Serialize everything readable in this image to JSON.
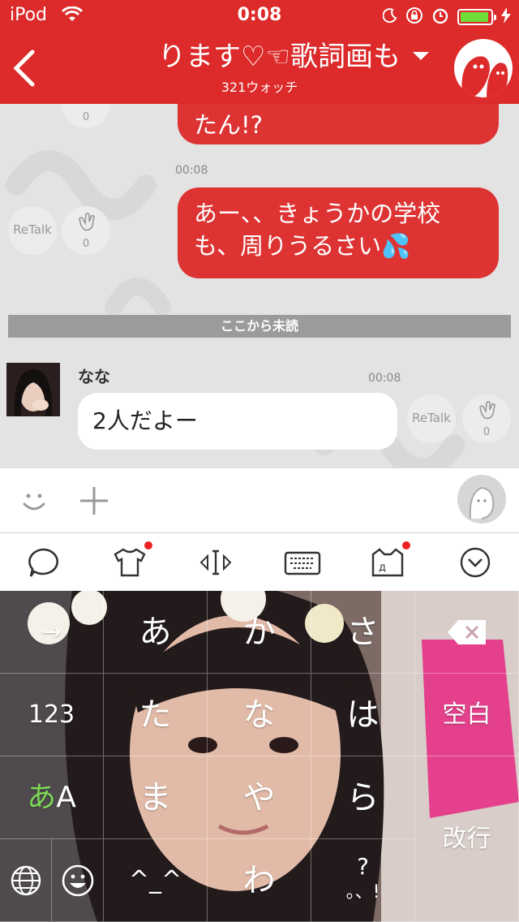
{
  "status_bar": {
    "carrier": "iPod",
    "time": "0:08",
    "battery_level": 0.95,
    "colors": {
      "battery_fill": "#6ddd3a"
    }
  },
  "nav": {
    "title": "ります♡☜歌詞画も",
    "subtitle": "321ウォッチ",
    "colors": {
      "header_bg": "#dd2a2a"
    }
  },
  "chat": {
    "messages": [
      {
        "type": "outgoing",
        "text": "たん!?",
        "reactions": {
          "clap_count": "0"
        }
      },
      {
        "type": "outgoing",
        "time": "00:08",
        "text": "あー、、きょうかの学校も、周りうるさい💦",
        "reactions": {
          "retalk": "ReTalk",
          "clap_count": "0"
        }
      },
      {
        "type": "incoming",
        "sender": "なな",
        "time": "00:08",
        "text": "2人だよー",
        "reactions": {
          "retalk": "ReTalk",
          "clap_count": "0"
        }
      }
    ],
    "unread_divider": "ここから未読",
    "colors": {
      "outgoing_bubble": "#dd3333",
      "incoming_bubble": "#ffffff",
      "divider_bg": "#9b9b9b"
    }
  },
  "input_bar": {
    "icons": [
      "smile-icon",
      "plus-icon",
      "stamp-icon"
    ]
  },
  "keyboard_toolbar": {
    "icons": [
      "speech-bubble-icon",
      "tshirt-icon",
      "cursor-move-icon",
      "keyboard-icon",
      "cat-face-icon",
      "chevron-down-circle-icon"
    ]
  },
  "keyboard": {
    "keys": {
      "arrow": "→",
      "a": "あ",
      "ka": "か",
      "sa": "さ",
      "num": "123",
      "ta": "た",
      "na": "な",
      "ha": "は",
      "space": "空白",
      "mode_a": "あ",
      "mode_A": "A",
      "ma": "ま",
      "ya": "や",
      "ra": "ら",
      "enter": "改行",
      "emoticon": "^_^",
      "wa": "わ",
      "punct_top": "?",
      "punct_bottom": "。、!"
    },
    "colors": {
      "mode_a_color": "#7ed957"
    }
  }
}
